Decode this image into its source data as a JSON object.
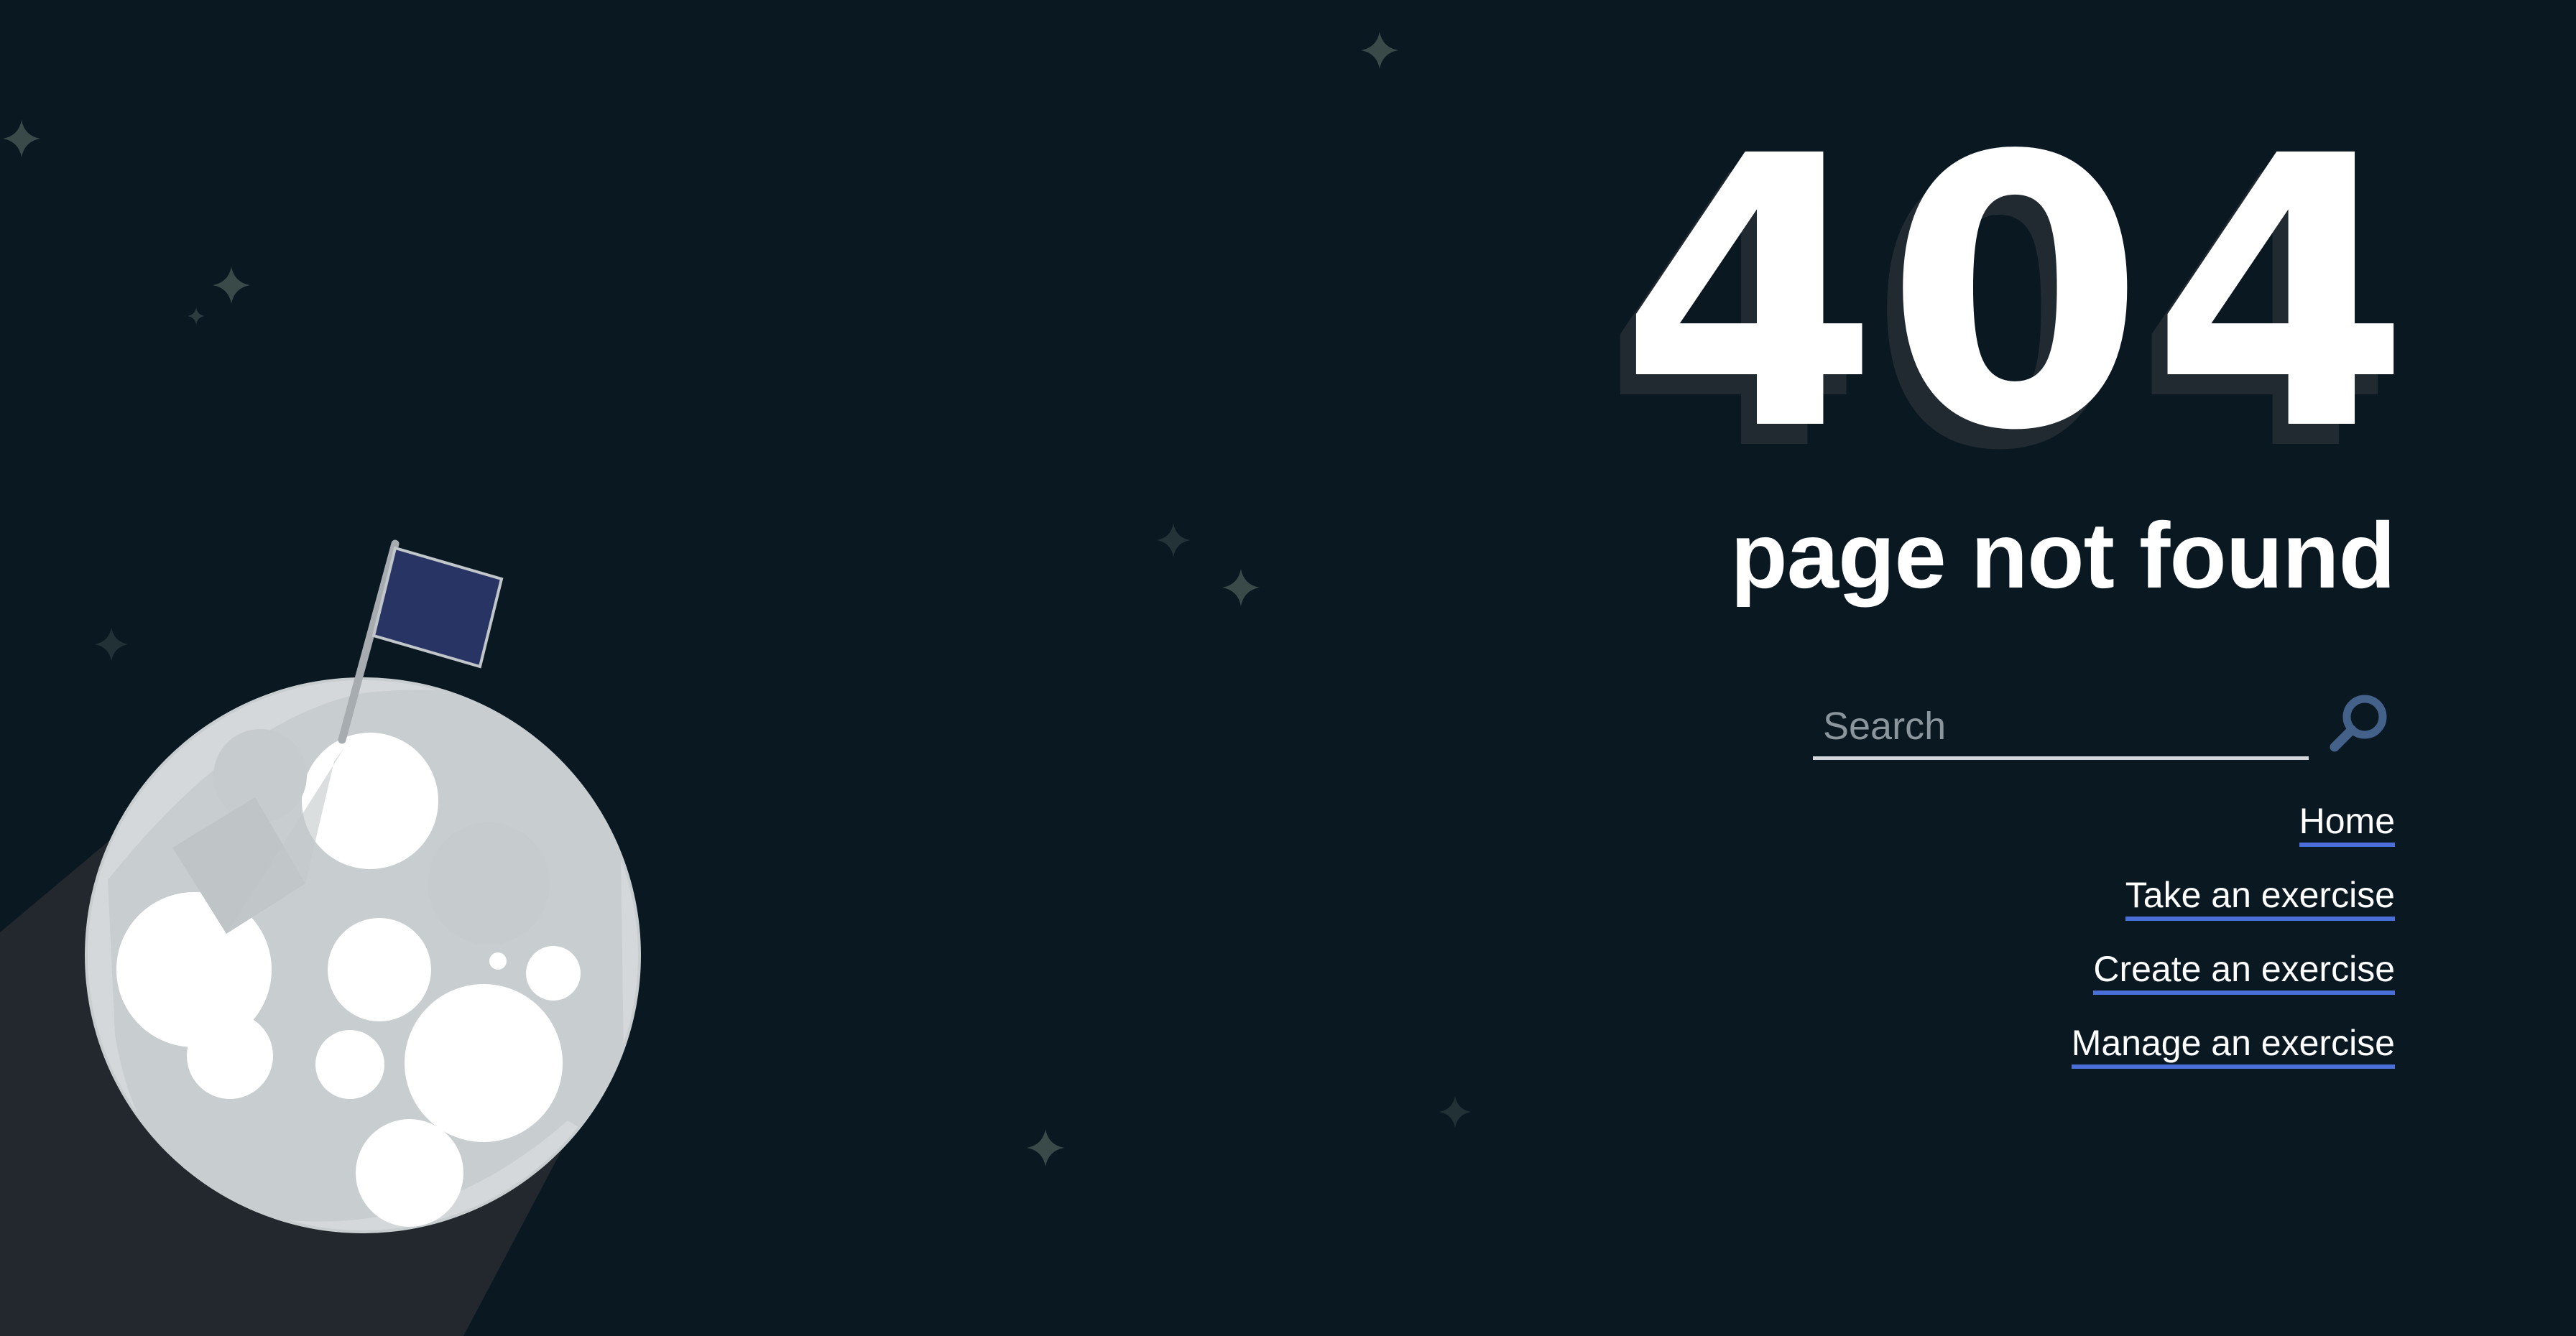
{
  "error": {
    "code": "404",
    "message": "page not found"
  },
  "search": {
    "placeholder": "Search",
    "value": "",
    "icon": "search-icon"
  },
  "nav": {
    "links": [
      {
        "label": "Home"
      },
      {
        "label": "Take an exercise"
      },
      {
        "label": "Create an exercise"
      },
      {
        "label": "Manage an exercise"
      }
    ]
  },
  "illustration": {
    "moon_icon": "moon-icon",
    "flag_icon": "flag-icon",
    "star_icon": "star-icon"
  },
  "colors": {
    "background": "#0a1822",
    "accent": "#4a6fd8",
    "flag": "#283463",
    "moon": "#d5d8da",
    "star": "#3a4a48",
    "search_icon": "#44618a"
  }
}
